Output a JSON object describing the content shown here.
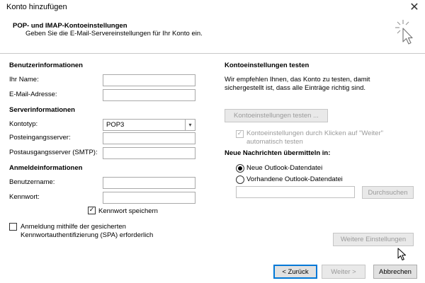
{
  "window": {
    "title": "Konto hinzufügen",
    "close_glyph": "✕"
  },
  "header": {
    "title": "POP- und IMAP-Kontoeinstellungen",
    "subtitle": "Geben Sie die E-Mail-Servereinstellungen für Ihr Konto ein.",
    "icon": "wizard-cursor-icon"
  },
  "user_info": {
    "heading": "Benutzerinformationen",
    "name_label": "Ihr Name:",
    "name_value": "",
    "email_label": "E-Mail-Adresse:",
    "email_value": ""
  },
  "server_info": {
    "heading": "Serverinformationen",
    "account_type_label": "Kontotyp:",
    "account_type_value": "POP3",
    "incoming_label": "Posteingangsserver:",
    "incoming_value": "",
    "outgoing_label": "Postausgangsserver (SMTP):",
    "outgoing_value": ""
  },
  "login_info": {
    "heading": "Anmeldeinformationen",
    "username_label": "Benutzername:",
    "username_value": "",
    "password_label": "Kennwort:",
    "password_value": "",
    "remember_password_label": "Kennwort speichern",
    "remember_password_checked": true,
    "spa_label_line1": "Anmeldung mithilfe der gesicherten",
    "spa_label_line2": "Kennwortauthentifizierung (SPA) erforderlich",
    "spa_checked": false
  },
  "test_settings": {
    "heading": "Kontoeinstellungen testen",
    "description_line1": "Wir empfehlen Ihnen, das Konto zu testen, damit",
    "description_line2": "sichergestellt ist, dass alle Einträge richtig sind.",
    "test_button": "Kontoeinstellungen testen ...",
    "auto_test_line1": "Kontoeinstellungen durch Klicken auf \"Weiter\"",
    "auto_test_line2": "automatisch testen",
    "auto_test_checked": true
  },
  "deliver": {
    "heading": "Neue Nachrichten übermitteln in:",
    "option_new": "Neue Outlook-Datendatei",
    "option_existing": "Vorhandene Outlook-Datendatei",
    "selected": "new",
    "file_path": "",
    "browse_button": "Durchsuchen"
  },
  "more_settings_button": "Weitere Einstellungen",
  "footer": {
    "back": "< Zurück",
    "next": "Weiter >",
    "cancel": "Abbrechen"
  },
  "icons": {
    "check": "✓",
    "dropdown": "▾"
  },
  "colors": {
    "focus_blue": "#0078d7",
    "disabled_gray": "#9a9a9a"
  }
}
